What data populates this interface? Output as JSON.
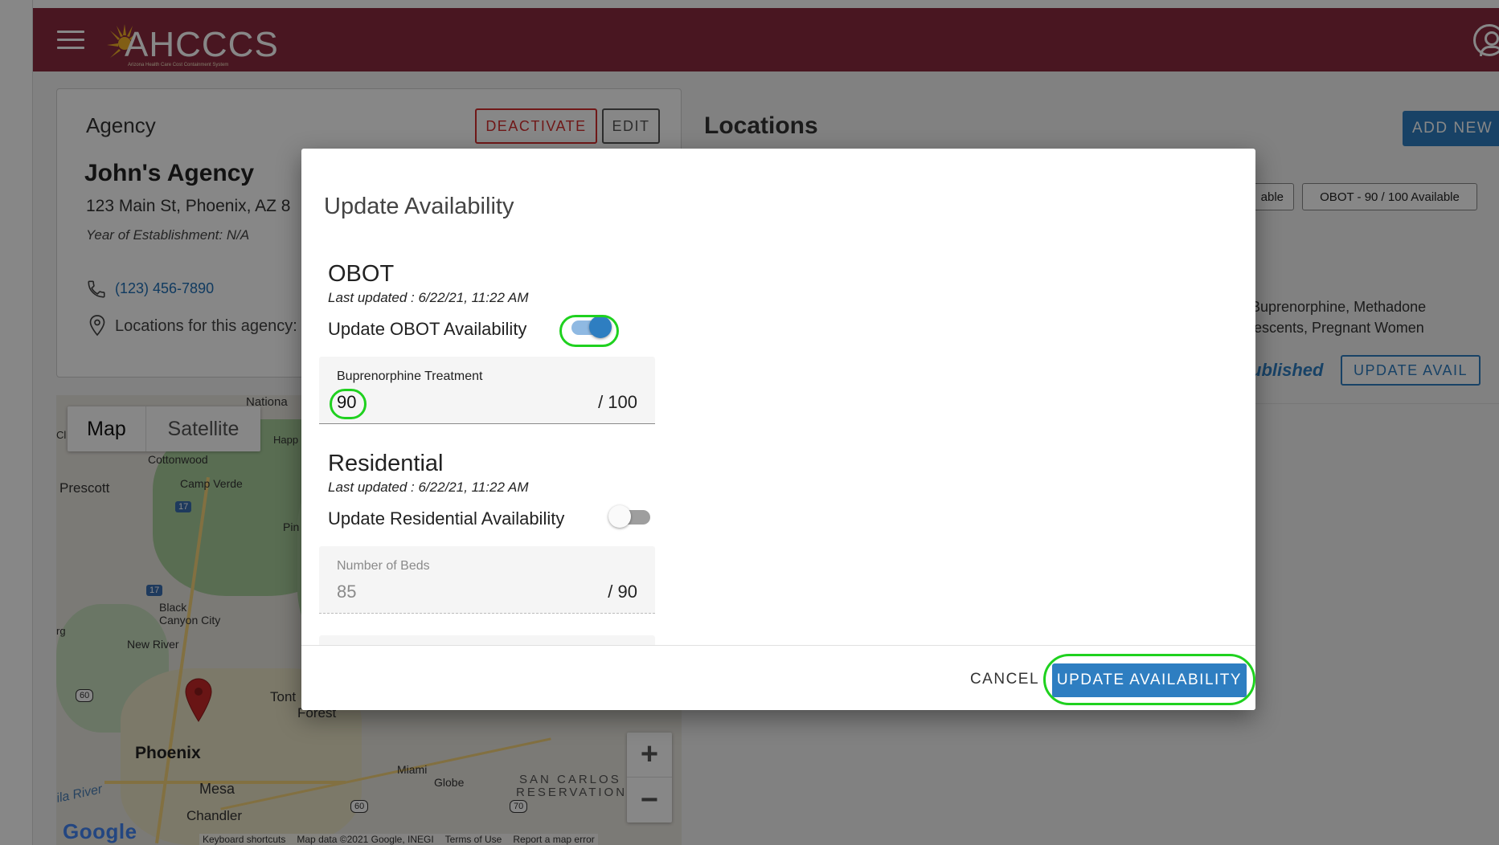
{
  "header": {
    "logo_text": "AHCCCS",
    "logo_subtitle": "Arizona Health Care Cost Containment System"
  },
  "agency": {
    "section_label": "Agency",
    "deactivate_label": "DEACTIVATE",
    "edit_label": "EDIT",
    "name": "John's Agency",
    "address": "123 Main St, Phoenix, AZ 8",
    "year": "Year of Establishment: N/A",
    "phone": "(123) 456-7890",
    "locations_text": "Locations for this agency:"
  },
  "map": {
    "map_label": "Map",
    "satellite_label": "Satellite",
    "places": [
      "Nationa",
      "Happ",
      "Cottonwood",
      "Prescott",
      "Camp Verde",
      "Pin",
      "Black",
      "Canyon City",
      "New River",
      "rg",
      "Cl",
      "Tont",
      "Forest",
      "Phoenix",
      "Mesa",
      "Chandler",
      "Miami",
      "Globe",
      "ila River"
    ],
    "reservation": [
      "SAN CARLOS",
      "RESERVATION"
    ],
    "shields": [
      "17",
      "17",
      "60",
      "60",
      "70"
    ],
    "zoom_in": "+",
    "zoom_out": "−",
    "google": "Google",
    "footer": [
      "Keyboard shortcuts",
      "Map data ©2021 Google, INEGI",
      "Terms of Use",
      "Report a map error"
    ]
  },
  "locations": {
    "title": "Locations",
    "add_new_label": "ADD NEW",
    "chip_partial": "able",
    "chip_obot": "OBOT - 90 / 100 Available",
    "services": "Buprenorphine, Methadone",
    "populations": "lescents, Pregnant Women",
    "status": "ublished",
    "update_avail_label": "UPDATE AVAIL"
  },
  "dialog": {
    "title": "Update Availability",
    "obot": {
      "title": "OBOT",
      "last_updated": "Last updated : 6/22/21, 11:22 AM",
      "toggle_label": "Update OBOT Availability",
      "toggle_on": true,
      "field_label": "Buprenorphine Treatment",
      "field_value": "90",
      "field_total": "/ 100"
    },
    "residential": {
      "title": "Residential",
      "last_updated": "Last updated : 6/22/21, 11:22 AM",
      "toggle_label": "Update Residential Availability",
      "toggle_on": false,
      "field_label": "Number of Beds",
      "field_value": "85",
      "field_total": "/ 90"
    },
    "cancel_label": "CANCEL",
    "update_label": "UPDATE AVAILABILITY"
  },
  "colors": {
    "header": "#8a2a3f",
    "primary": "#2e7ec1",
    "danger": "#d32f2f",
    "highlight": "#1fd11f"
  }
}
